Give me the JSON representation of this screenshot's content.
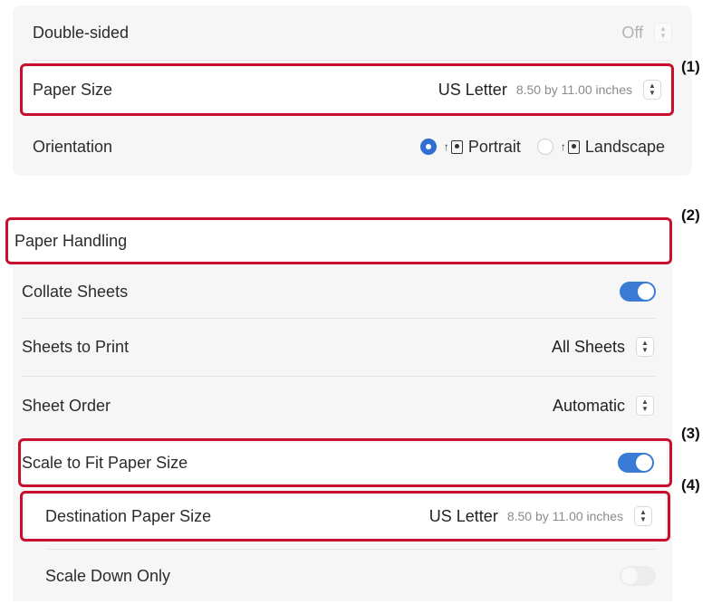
{
  "top_section": {
    "double_sided": {
      "label": "Double-sided",
      "value": "Off"
    },
    "paper_size": {
      "label": "Paper Size",
      "value": "US Letter",
      "detail": "8.50 by 11.00 inches"
    },
    "orientation": {
      "label": "Orientation",
      "portrait_label": "Portrait",
      "landscape_label": "Landscape",
      "selected": "Portrait"
    }
  },
  "paper_handling": {
    "header": "Paper Handling",
    "collate_sheets": {
      "label": "Collate Sheets",
      "enabled": true
    },
    "sheets_to_print": {
      "label": "Sheets to Print",
      "value": "All Sheets"
    },
    "sheet_order": {
      "label": "Sheet Order",
      "value": "Automatic"
    },
    "scale_to_fit": {
      "label": "Scale to Fit Paper Size",
      "enabled": true
    },
    "destination_paper_size": {
      "label": "Destination Paper Size",
      "value": "US Letter",
      "detail": "8.50 by 11.00 inches"
    },
    "scale_down_only": {
      "label": "Scale Down Only",
      "enabled": false
    }
  },
  "callouts": [
    "(1)",
    "(2)",
    "(3)",
    "(4)"
  ],
  "colors": {
    "highlight": "#c8102e",
    "accent": "#3a7bd5",
    "panel": "#f6f6f6"
  },
  "icons": {
    "stepper": "up-down-chevron-icon",
    "portrait": "portrait-orientation-icon",
    "landscape": "landscape-orientation-icon"
  }
}
